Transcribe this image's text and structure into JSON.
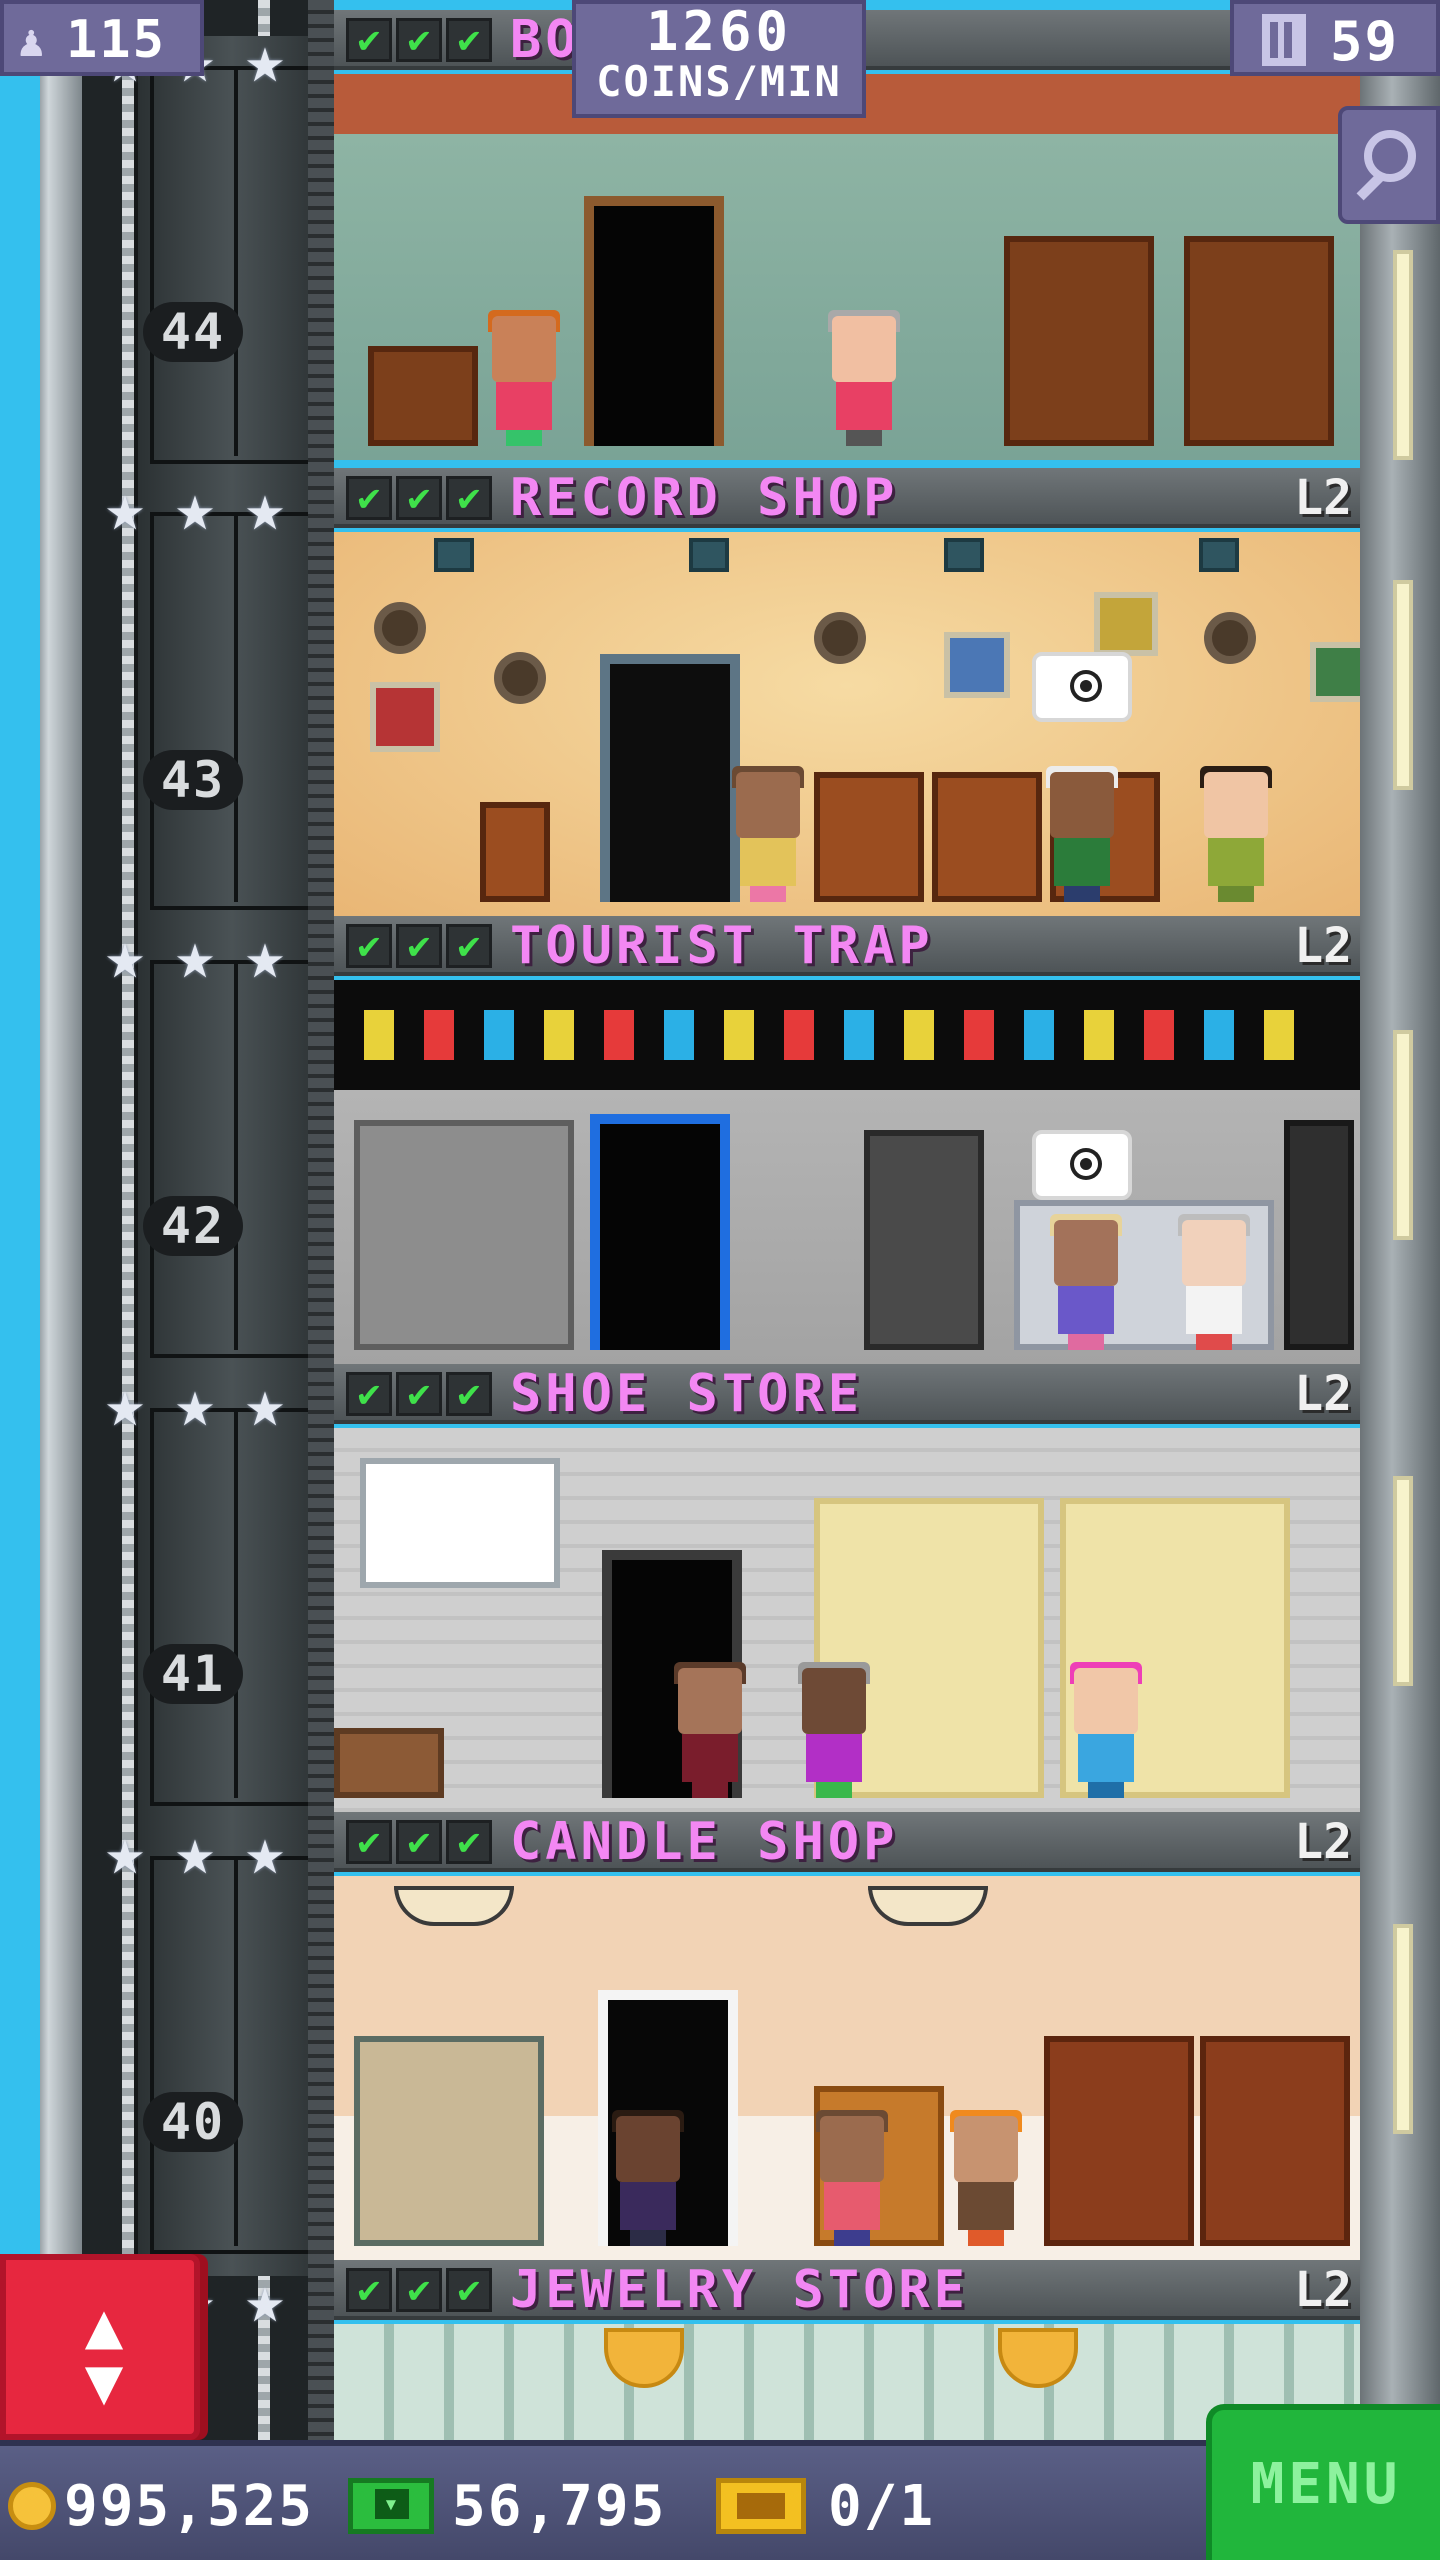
{
  "hud": {
    "population": "115",
    "coins_per_min_value": "1260",
    "coins_per_min_label": "COINS/MIN",
    "floor_count": "59"
  },
  "floors": [
    {
      "name": "BO",
      "level": "",
      "number": "44"
    },
    {
      "name": "RECORD SHOP",
      "level": "L2",
      "number": "43"
    },
    {
      "name": "TOURIST TRAP",
      "level": "L2",
      "number": "42"
    },
    {
      "name": "SHOE STORE",
      "level": "L2",
      "number": "41"
    },
    {
      "name": "CANDLE SHOP",
      "level": "L2",
      "number": "40"
    },
    {
      "name": "JEWELRY STORE",
      "level": "L2",
      "number": ""
    }
  ],
  "check_mark": "✔",
  "star_glyph": "★",
  "bottom_bar": {
    "coins": "995,525",
    "bux": "56,795",
    "tickets": "0/1",
    "menu_label": "MENU"
  },
  "elevator_button": {
    "up_arrow": "▲",
    "down_arrow": "▼"
  },
  "colors": {
    "floor_name": "#f387f3",
    "check": "#3fe14a",
    "menu_button": "#21b63c",
    "elevator_button": "#e7273f",
    "hud_panel": "#6f6a9a"
  }
}
